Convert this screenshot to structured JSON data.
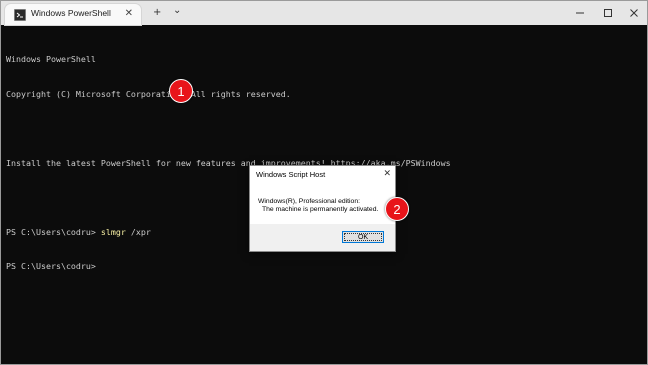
{
  "window": {
    "tab_title": "Windows PowerShell",
    "tab_close_glyph": "✕",
    "new_tab_glyph": "+",
    "dropdown_glyph": "⌄"
  },
  "console": {
    "lines": [
      "Windows PowerShell",
      "Copyright (C) Microsoft Corporation. All rights reserved.",
      "",
      "Install the latest PowerShell for new features and improvements! https://aka.ms/PSWindows",
      ""
    ],
    "prompt1": "PS C:\\Users\\codru> ",
    "command_name": "slmgr",
    "command_args": " /xpr",
    "prompt2": "PS C:\\Users\\codru>"
  },
  "badges": {
    "one": "1",
    "two": "2",
    "color": "#e8141a"
  },
  "dialog": {
    "title": "Windows Script Host",
    "close_glyph": "✕",
    "message_line1": "Windows(R), Professional edition:",
    "message_line2": "The machine is permanently activated.",
    "ok_label": "OK"
  }
}
